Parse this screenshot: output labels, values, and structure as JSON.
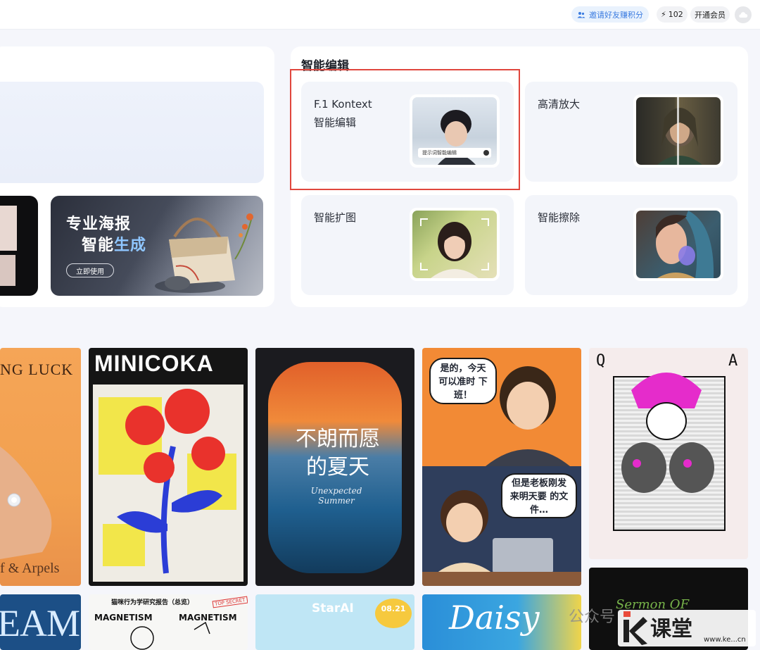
{
  "topbar": {
    "invite_label": "邀请好友赚积分",
    "credits": "102",
    "member_label": "开通会员"
  },
  "promo": {
    "title_line1": "专业海报",
    "title_line2_a": "智能",
    "title_line2_b": "生成",
    "button_label": "立即使用"
  },
  "smart_edit": {
    "section_title": "智能编辑",
    "tools": [
      {
        "line1": "F.1 Kontext",
        "line2": "智能编辑",
        "thumb_caption": "提示词智能编辑"
      },
      {
        "line1": "高清放大",
        "line2": ""
      },
      {
        "line1": "智能扩图",
        "line2": ""
      },
      {
        "line1": "智能擦除",
        "line2": ""
      }
    ]
  },
  "gallery": {
    "items": [
      {
        "title": "NG LUCK",
        "subtitle": "f & Arpels"
      },
      {
        "title": "MINICOKA"
      },
      {
        "title": "不朗而愿 的夏天",
        "subtitle": "Unexpected Summer"
      },
      {
        "bubble1": "是的，今天 可以准时 下班！",
        "bubble2": "但是老板刚发 来明天要 的文件…"
      },
      {
        "title": "Q A"
      },
      {
        "title": "EAM"
      },
      {
        "title": "猫咪行为学研究报告（总览）",
        "tag": "TOP SECRET",
        "word1": "MAGNETISM",
        "word2": "MAGNETISM"
      },
      {
        "title": "StarAI",
        "date": "08.21"
      },
      {
        "title": "Daisy"
      },
      {
        "title": "Sermon OF"
      }
    ]
  },
  "watermark": {
    "text": "公众号",
    "logo": "课堂",
    "url": "www.ke...cn"
  },
  "colors": {
    "accent_blue": "#3a7be0",
    "highlight_red": "#e0463d"
  }
}
